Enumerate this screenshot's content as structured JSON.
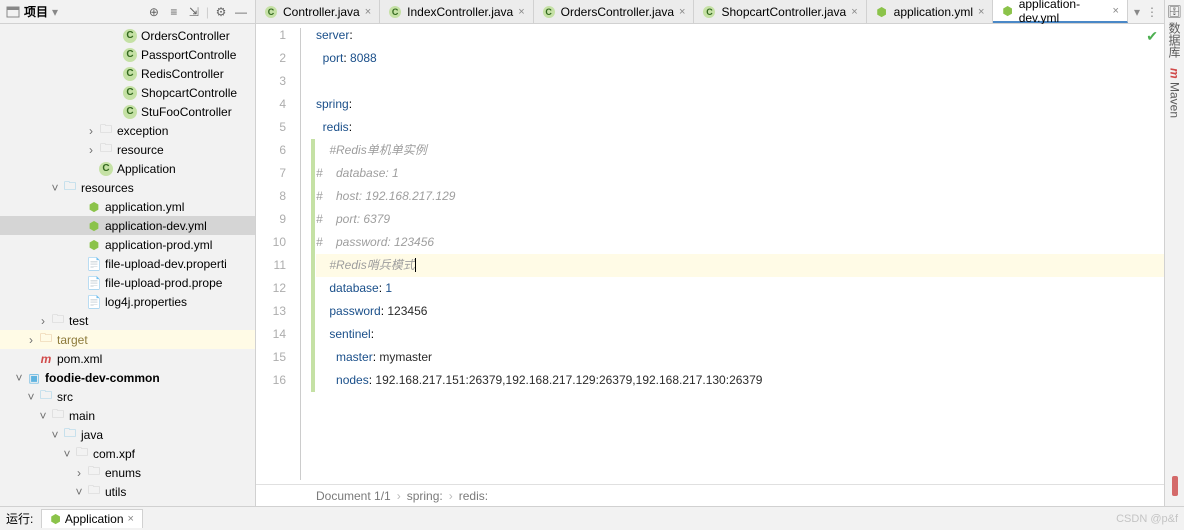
{
  "project_panel": {
    "title": "项目",
    "tree": [
      {
        "indent": 9,
        "kind": "class",
        "label": "OrdersController"
      },
      {
        "indent": 9,
        "kind": "class",
        "label": "PassportControlle"
      },
      {
        "indent": 9,
        "kind": "class",
        "label": "RedisController"
      },
      {
        "indent": 9,
        "kind": "class",
        "label": "ShopcartControlle"
      },
      {
        "indent": 9,
        "kind": "class",
        "label": "StuFooController"
      },
      {
        "indent": 7,
        "tw": ">",
        "kind": "folder",
        "label": "exception"
      },
      {
        "indent": 7,
        "tw": ">",
        "kind": "folder",
        "label": "resource"
      },
      {
        "indent": 7,
        "kind": "class",
        "label": "Application"
      },
      {
        "indent": 4,
        "tw": "v",
        "kind": "folder-res",
        "label": "resources"
      },
      {
        "indent": 6,
        "kind": "yml",
        "label": "application.yml"
      },
      {
        "indent": 6,
        "kind": "yml",
        "label": "application-dev.yml",
        "sel": true
      },
      {
        "indent": 6,
        "kind": "yml",
        "label": "application-prod.yml"
      },
      {
        "indent": 6,
        "kind": "prop",
        "label": "file-upload-dev.properti"
      },
      {
        "indent": 6,
        "kind": "prop",
        "label": "file-upload-prod.prope"
      },
      {
        "indent": 6,
        "kind": "prop",
        "label": "log4j.properties"
      },
      {
        "indent": 3,
        "tw": ">",
        "kind": "folder",
        "label": "test"
      },
      {
        "indent": 2,
        "tw": ">",
        "kind": "folder-ex",
        "label": "target",
        "excl": true
      },
      {
        "indent": 2,
        "kind": "maven",
        "label": "pom.xml"
      },
      {
        "indent": 1,
        "tw": "v",
        "kind": "module",
        "label": "foodie-dev-common",
        "bold": true
      },
      {
        "indent": 2,
        "tw": "v",
        "kind": "folder-java",
        "label": "src"
      },
      {
        "indent": 3,
        "tw": "v",
        "kind": "folder",
        "label": "main"
      },
      {
        "indent": 4,
        "tw": "v",
        "kind": "folder-java",
        "label": "java"
      },
      {
        "indent": 5,
        "tw": "v",
        "kind": "folder",
        "label": "com.xpf"
      },
      {
        "indent": 6,
        "tw": ">",
        "kind": "folder",
        "label": "enums"
      },
      {
        "indent": 6,
        "tw": "v",
        "kind": "folder",
        "label": "utils"
      }
    ]
  },
  "tabs": [
    {
      "kind": "class",
      "label": "Controller.java"
    },
    {
      "kind": "class",
      "label": "IndexController.java"
    },
    {
      "kind": "class",
      "label": "OrdersController.java"
    },
    {
      "kind": "class",
      "label": "ShopcartController.java"
    },
    {
      "kind": "yml",
      "label": "application.yml"
    },
    {
      "kind": "yml",
      "label": "application-dev.yml",
      "active": true
    }
  ],
  "code": {
    "lines": [
      {
        "n": 1,
        "chg": false,
        "html": "<span class='key'>server</span>:",
        "pad": 0
      },
      {
        "n": 2,
        "chg": false,
        "html": "  <span class='key'>port</span>: <span class='num'>8088</span>",
        "pad": 0
      },
      {
        "n": 3,
        "chg": false,
        "html": "",
        "pad": 0
      },
      {
        "n": 4,
        "chg": false,
        "html": "<span class='key'>spring</span>:",
        "pad": 0
      },
      {
        "n": 5,
        "chg": false,
        "html": "  <span class='key'>redis</span>:",
        "pad": 0
      },
      {
        "n": 6,
        "chg": true,
        "html": "    <span class='cmt'>#Redis单机单实例</span>",
        "pad": 0
      },
      {
        "n": 7,
        "chg": true,
        "html": "<span class='cmt'>#    database: 1</span>",
        "pad": 0
      },
      {
        "n": 8,
        "chg": true,
        "html": "<span class='cmt'>#    host: 192.168.217.129</span>",
        "pad": 0
      },
      {
        "n": 9,
        "chg": true,
        "html": "<span class='cmt'>#    port: 6379</span>",
        "pad": 0
      },
      {
        "n": 10,
        "chg": true,
        "html": "<span class='cmt'>#    password: 123456</span>",
        "pad": 0
      },
      {
        "n": 11,
        "chg": true,
        "hl": true,
        "html": "    <span class='cmt'>#Redis哨兵模式</span><span class='caret'></span>",
        "pad": 0
      },
      {
        "n": 12,
        "chg": true,
        "html": "    <span class='key'>database</span>: <span class='num'>1</span>",
        "pad": 0
      },
      {
        "n": 13,
        "chg": true,
        "html": "    <span class='key'>password</span>: <span class='txt'>123456</span>",
        "pad": 0
      },
      {
        "n": 14,
        "chg": true,
        "html": "    <span class='key'>sentinel</span>:",
        "pad": 0
      },
      {
        "n": 15,
        "chg": true,
        "html": "      <span class='key'>master</span>: <span class='txt'>mymaster</span>",
        "pad": 0
      },
      {
        "n": 16,
        "chg": true,
        "html": "      <span class='key'>nodes</span>: <span class='txt'>192.168.217.151:26379,192.168.217.129:26379,192.168.217.130:26379</span>",
        "pad": 0
      }
    ]
  },
  "breadcrumb": [
    "Document 1/1",
    "spring:",
    "redis:"
  ],
  "run": {
    "label": "运行:",
    "tab": "Application"
  },
  "right_tools": [
    "数据库",
    "Maven"
  ],
  "watermark": "CSDN @p&f"
}
